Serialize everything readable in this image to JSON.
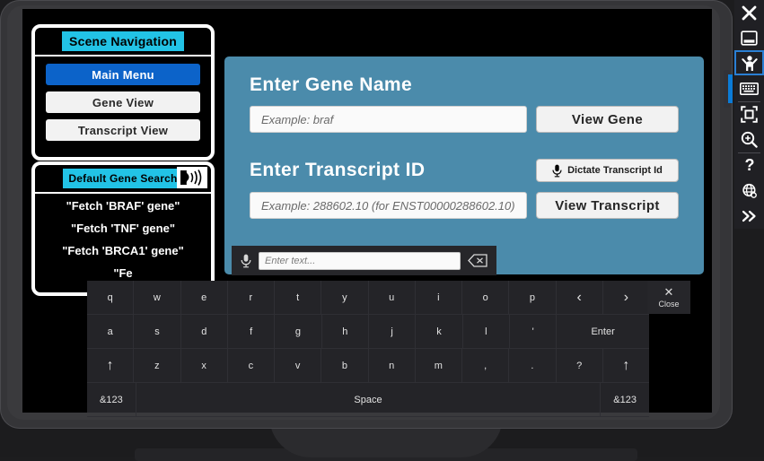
{
  "navigation_panel": {
    "title": "Scene Navigation",
    "buttons": [
      {
        "label": "Main Menu",
        "active": true
      },
      {
        "label": "Gene View",
        "active": false
      },
      {
        "label": "Transcript View",
        "active": false
      }
    ]
  },
  "search_panel": {
    "title": "Default Gene Search",
    "speaker_icon": "speaking-head-icon",
    "items": [
      "\"Fetch 'BRAF' gene\"",
      "\"Fetch 'TNF' gene\"",
      "\"Fetch 'BRCA1' gene\"",
      "\"Fe"
    ]
  },
  "main_card": {
    "gene": {
      "heading": "Enter Gene Name",
      "input_value": "",
      "input_placeholder": "Example: braf",
      "button_label": "View Gene"
    },
    "transcript": {
      "heading": "Enter Transcript ID",
      "input_value": "",
      "input_placeholder": "Example: 288602.10 (for ENST00000288602.10)",
      "dictate_label": "Dictate Transcript Id",
      "dictate_icon": "microphone-icon",
      "button_label": "View Transcript"
    }
  },
  "dictation_bar": {
    "mic_icon": "microphone-icon",
    "input_value": "",
    "input_placeholder": "Enter text...",
    "backspace_icon": "backspace-icon"
  },
  "keyboard": {
    "close_label": "Close",
    "close_icon": "close-icon",
    "rows": [
      [
        {
          "label": "q"
        },
        {
          "label": "w"
        },
        {
          "label": "e"
        },
        {
          "label": "r"
        },
        {
          "label": "t"
        },
        {
          "label": "y"
        },
        {
          "label": "u"
        },
        {
          "label": "i"
        },
        {
          "label": "o"
        },
        {
          "label": "p"
        },
        {
          "label": "‹",
          "glyph": true
        },
        {
          "label": "›",
          "glyph": true
        }
      ],
      [
        {
          "label": "a"
        },
        {
          "label": "s"
        },
        {
          "label": "d"
        },
        {
          "label": "f"
        },
        {
          "label": "g"
        },
        {
          "label": "h"
        },
        {
          "label": "j"
        },
        {
          "label": "k"
        },
        {
          "label": "l"
        },
        {
          "label": "'"
        },
        {
          "label": "Enter",
          "wide": 2
        }
      ],
      [
        {
          "label": "↑",
          "glyph": true
        },
        {
          "label": "z"
        },
        {
          "label": "x"
        },
        {
          "label": "c"
        },
        {
          "label": "v"
        },
        {
          "label": "b"
        },
        {
          "label": "n"
        },
        {
          "label": "m"
        },
        {
          "label": ","
        },
        {
          "label": "."
        },
        {
          "label": "?"
        },
        {
          "label": "↑",
          "glyph": true
        }
      ],
      [
        {
          "label": "&123"
        },
        {
          "label": "Space",
          "wide": 9.6
        },
        {
          "label": "&123"
        }
      ]
    ]
  },
  "toolbar": {
    "items": [
      {
        "name": "close-icon",
        "selected": false
      },
      {
        "name": "minimize-window-icon",
        "selected": false
      },
      {
        "name": "avatar-person-icon",
        "selected": true
      },
      {
        "name": "keyboard-icon",
        "selected": false
      },
      {
        "name": "fullscreen-icon",
        "selected": false
      },
      {
        "name": "zoom-in-icon",
        "selected": false
      },
      {
        "name": "help-icon",
        "selected": false
      },
      {
        "name": "globe-settings-icon",
        "selected": false
      },
      {
        "name": "chevron-double-right-icon",
        "selected": false
      }
    ]
  },
  "colors": {
    "card_blue": "#4b8bab",
    "title_cyan": "#22c3e6",
    "active_blue": "#0c63c9",
    "accent_blue": "#0b7bd6",
    "panel_black": "#000000",
    "keyboard_bg": "#242428"
  }
}
